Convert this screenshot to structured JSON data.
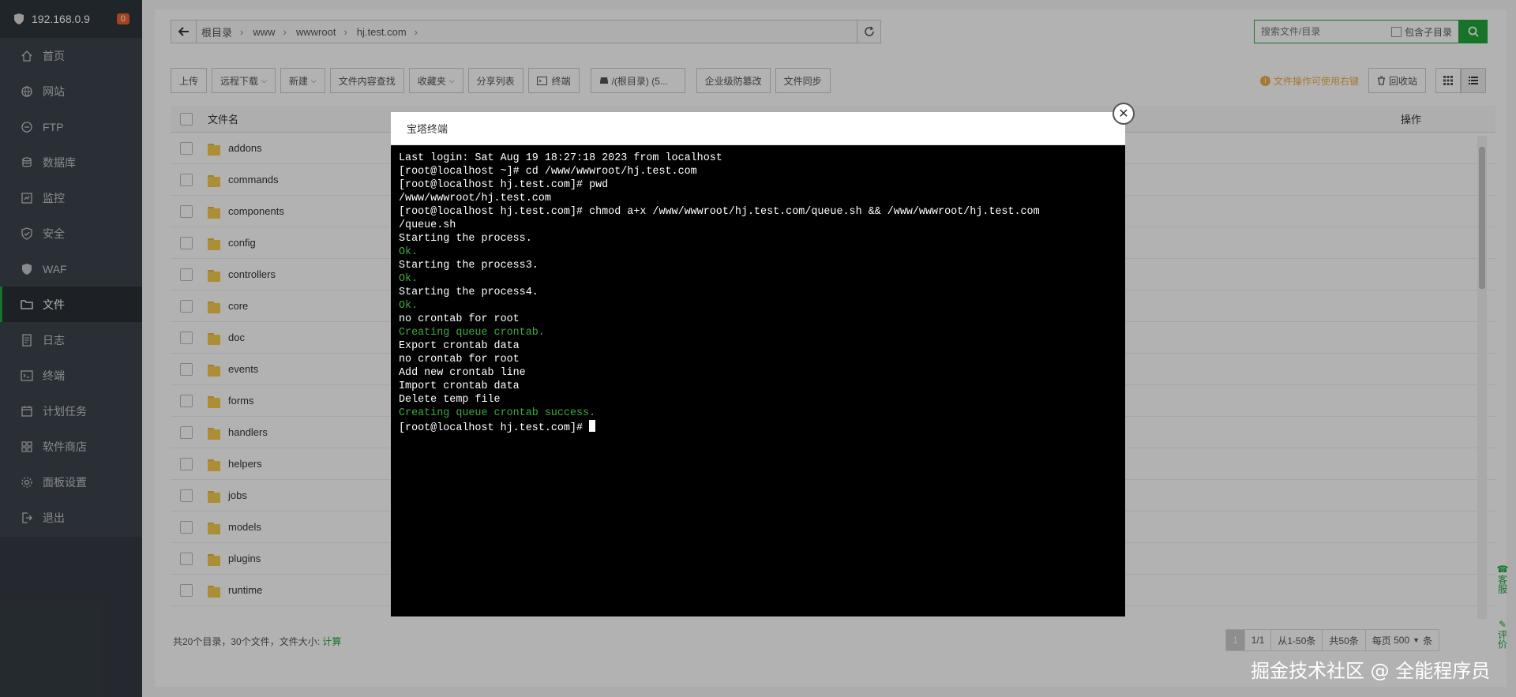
{
  "sidebar": {
    "ip": "192.168.0.9",
    "badge": "0",
    "items": [
      {
        "label": "首页",
        "icon": "home-icon"
      },
      {
        "label": "网站",
        "icon": "globe-icon"
      },
      {
        "label": "FTP",
        "icon": "ftp-icon"
      },
      {
        "label": "数据库",
        "icon": "database-icon"
      },
      {
        "label": "监控",
        "icon": "monitor-icon"
      },
      {
        "label": "安全",
        "icon": "shield-icon"
      },
      {
        "label": "WAF",
        "icon": "waf-icon"
      },
      {
        "label": "文件",
        "icon": "folder-icon",
        "active": true
      },
      {
        "label": "日志",
        "icon": "log-icon"
      },
      {
        "label": "终端",
        "icon": "terminal-icon"
      },
      {
        "label": "计划任务",
        "icon": "calendar-icon"
      },
      {
        "label": "软件商店",
        "icon": "apps-icon"
      },
      {
        "label": "面板设置",
        "icon": "gear-icon"
      },
      {
        "label": "退出",
        "icon": "logout-icon"
      }
    ]
  },
  "path": {
    "crumbs": [
      "根目录",
      "www",
      "wwwroot",
      "hj.test.com"
    ]
  },
  "search": {
    "placeholder": "搜索文件/目录",
    "include_subdir": "包含子目录"
  },
  "toolbar": {
    "buttons": [
      "上传",
      "远程下载",
      "新建",
      "文件内容查找",
      "收藏夹",
      "分享列表",
      "终端",
      "/(根目录) (5...",
      "企业级防篡改",
      "文件同步"
    ],
    "tip": "文件操作可使用右键",
    "recycle": "回收站"
  },
  "table": {
    "col_name": "文件名",
    "col_op": "操作",
    "rows": [
      "addons",
      "commands",
      "components",
      "config",
      "controllers",
      "core",
      "doc",
      "events",
      "forms",
      "handlers",
      "helpers",
      "jobs",
      "models",
      "plugins",
      "runtime"
    ]
  },
  "footer": {
    "summary": "共20个目录，30个文件，文件大小:",
    "calc": "计算",
    "pager": {
      "current": "1",
      "pages": "1/1",
      "range": "从1-50条",
      "total": "共50条",
      "per_page_label": "每页",
      "per_page": "500",
      "unit": "条"
    }
  },
  "sidetabs": {
    "service": "客服",
    "review": "评价"
  },
  "modal": {
    "title": "宝塔终端",
    "lines": [
      {
        "t": "Last login: Sat Aug 19 18:27:18 2023 from localhost",
        "c": "w"
      },
      {
        "t": "[root@localhost ~]# cd /www/wwwroot/hj.test.com",
        "c": "w"
      },
      {
        "t": "[root@localhost hj.test.com]# pwd",
        "c": "w"
      },
      {
        "t": "/www/wwwroot/hj.test.com",
        "c": "w"
      },
      {
        "t": "[root@localhost hj.test.com]# chmod a+x /www/wwwroot/hj.test.com/queue.sh && /www/wwwroot/hj.test.com",
        "c": "w"
      },
      {
        "t": "/queue.sh",
        "c": "w"
      },
      {
        "t": "Starting the process.",
        "c": "w"
      },
      {
        "t": "Ok.",
        "c": "g"
      },
      {
        "t": "Starting the process3.",
        "c": "w"
      },
      {
        "t": "Ok.",
        "c": "g"
      },
      {
        "t": "Starting the process4.",
        "c": "w"
      },
      {
        "t": "Ok.",
        "c": "g"
      },
      {
        "t": "no crontab for root",
        "c": "w"
      },
      {
        "t": "Creating queue crontab.",
        "c": "g"
      },
      {
        "t": "Export crontab data",
        "c": "w"
      },
      {
        "t": "no crontab for root",
        "c": "w"
      },
      {
        "t": "Add new crontab line",
        "c": "w"
      },
      {
        "t": "Import crontab data",
        "c": "w"
      },
      {
        "t": "Delete temp file",
        "c": "w"
      },
      {
        "t": "Creating queue crontab success.",
        "c": "g"
      }
    ],
    "prompt": "[root@localhost hj.test.com]# "
  },
  "watermark": "掘金技术社区 @ 全能程序员"
}
